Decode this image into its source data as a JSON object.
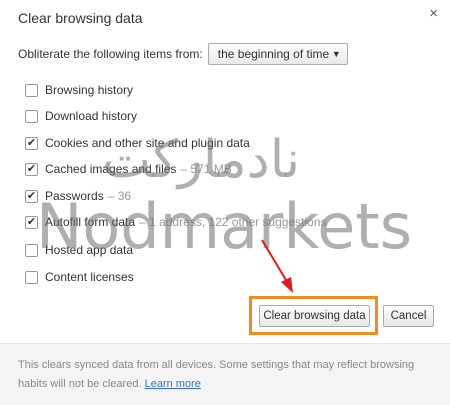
{
  "dialog": {
    "title": "Clear browsing data",
    "close_glyph": "×"
  },
  "obliterate": {
    "label": "Obliterate the following items from:",
    "selected": "the beginning of time"
  },
  "options": [
    {
      "label": "Browsing history",
      "detail": "",
      "checked": false
    },
    {
      "label": "Download history",
      "detail": "",
      "checked": false
    },
    {
      "label": "Cookies and other site and plugin data",
      "detail": "",
      "checked": true
    },
    {
      "label": "Cached images and files",
      "detail": "–  571 MB",
      "checked": true
    },
    {
      "label": "Passwords",
      "detail": "–  36",
      "checked": true
    },
    {
      "label": "Autofill form data",
      "detail": "–  1 address, 122 other suggestions",
      "checked": true
    },
    {
      "label": "Hosted app data",
      "detail": "",
      "checked": false
    },
    {
      "label": "Content licenses",
      "detail": "",
      "checked": false
    }
  ],
  "buttons": {
    "clear": "Clear browsing data",
    "cancel": "Cancel"
  },
  "footer": {
    "text": "This clears synced data from all devices. Some settings that may reflect browsing habits will not be cleared.",
    "link": "Learn more"
  },
  "watermark": {
    "persian": "نادمارکت",
    "english": "Nodmarkets"
  },
  "colors": {
    "highlight": "#f08c1f",
    "arrow": "#e01b1b",
    "link": "#3a6ec7"
  }
}
